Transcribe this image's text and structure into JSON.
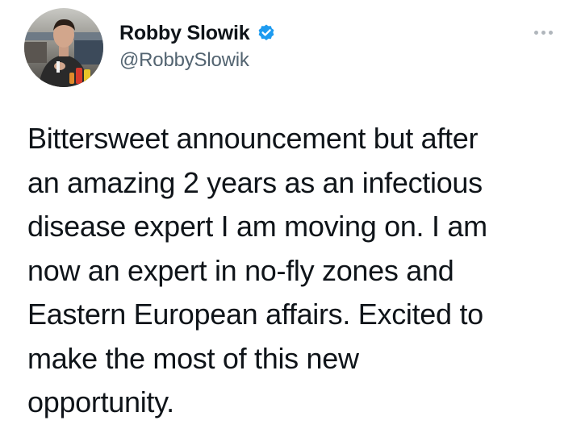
{
  "author": {
    "display_name": "Robby Slowik",
    "handle": "@RobbySlowik",
    "verified": true
  },
  "icons": {
    "verified": "verified-badge-icon",
    "more": "more-options-icon",
    "avatar": "profile-photo"
  },
  "colors": {
    "text": "#0f1419",
    "secondary": "#536471",
    "verified_blue": "#1d9bf0"
  },
  "tweet": {
    "lines": [
      "Bittersweet announcement but after",
      "an amazing 2 years as an infectious",
      "disease expert I am moving on. I am",
      "now an expert in no-fly zones and",
      "Eastern European affairs. Excited to",
      "make the most of this new",
      "opportunity."
    ]
  }
}
